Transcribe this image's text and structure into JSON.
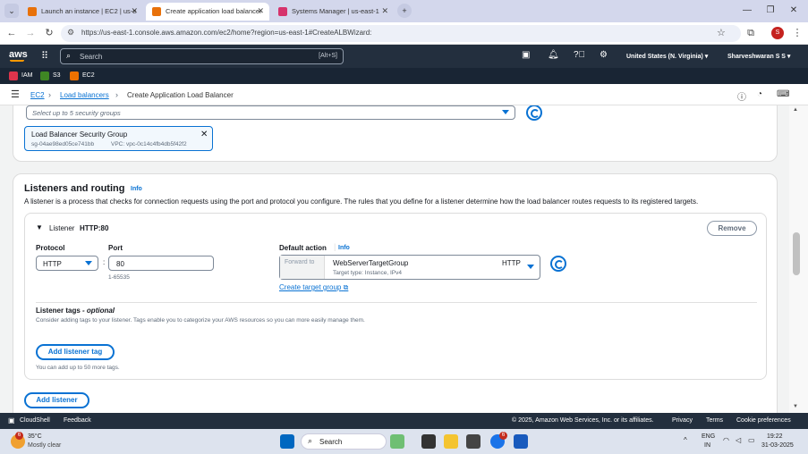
{
  "browser": {
    "tabs": [
      {
        "label": "Launch an instance | EC2 | us-e",
        "active": false,
        "favicon_color": "#e8710a"
      },
      {
        "label": "Create application load balancer",
        "active": true,
        "favicon_color": "#e8710a"
      },
      {
        "label": "Systems Manager | us-east-1",
        "active": false,
        "favicon_color": "#d6336c"
      }
    ],
    "new_tab_label": "+",
    "url": "https://us-east-1.console.aws.amazon.com/ec2/home?region=us-east-1#CreateALBWizard:",
    "profile_initial": "S"
  },
  "aws_nav": {
    "logo": "aws",
    "search_placeholder": "Search",
    "search_shortcut": "[Alt+S]",
    "region": "United States (N. Virginia)",
    "user": "Sharveshwaran S S"
  },
  "favorites": [
    {
      "label": "IAM",
      "color": "#dd344c"
    },
    {
      "label": "S3",
      "color": "#3f8624"
    },
    {
      "label": "EC2",
      "color": "#ed7100"
    }
  ],
  "breadcrumb": {
    "items": [
      "EC2",
      "Load balancers"
    ],
    "current": "Create Application Load Balancer"
  },
  "security_groups": {
    "placeholder": "Select up to 5 security groups",
    "selected": {
      "name": "Load Balancer Security Group",
      "id": "sg-04ae98ed05ce741bb",
      "vpc": "VPC: vpc-0c14c4fb4db5f42f2"
    }
  },
  "listeners": {
    "heading": "Listeners and routing",
    "info": "Info",
    "description": "A listener is a process that checks for connection requests using the port and protocol you configure. The rules that you define for a listener determine how the load balancer routes requests to its registered targets.",
    "listener_prefix": "Listener",
    "listener_name": "HTTP:80",
    "remove_label": "Remove",
    "protocol_label": "Protocol",
    "protocol_value": "HTTP",
    "port_label": "Port",
    "port_value": "80",
    "port_hint": "1-65535",
    "default_action_label": "Default action",
    "default_action_info": "Info",
    "forward_to": "Forward to",
    "target_group": "WebServerTargetGroup",
    "target_group_protocol": "HTTP",
    "target_type": "Target type: Instance, IPv4",
    "create_target_group": "Create target group",
    "tags_label": "Listener tags",
    "tags_optional": "- optional",
    "tags_description": "Consider adding tags to your listener. Tags enable you to categorize your AWS resources so you can more easily manage them.",
    "add_tag_label": "Add listener tag",
    "tags_hint": "You can add up to 50 more tags.",
    "add_listener_label": "Add listener"
  },
  "footer": {
    "cloudshell": "CloudShell",
    "feedback": "Feedback",
    "copyright": "© 2025, Amazon Web Services, Inc. or its affiliates.",
    "privacy": "Privacy",
    "terms": "Terms",
    "cookies": "Cookie preferences"
  },
  "taskbar": {
    "weather_temp": "35°C",
    "weather_desc": "Mostly clear",
    "weather_badge": "6",
    "search_label": "Search",
    "chrome_badge": "6",
    "lang_top": "ENG",
    "lang_bottom": "IN",
    "time": "19:22",
    "date": "31-03-2025"
  }
}
